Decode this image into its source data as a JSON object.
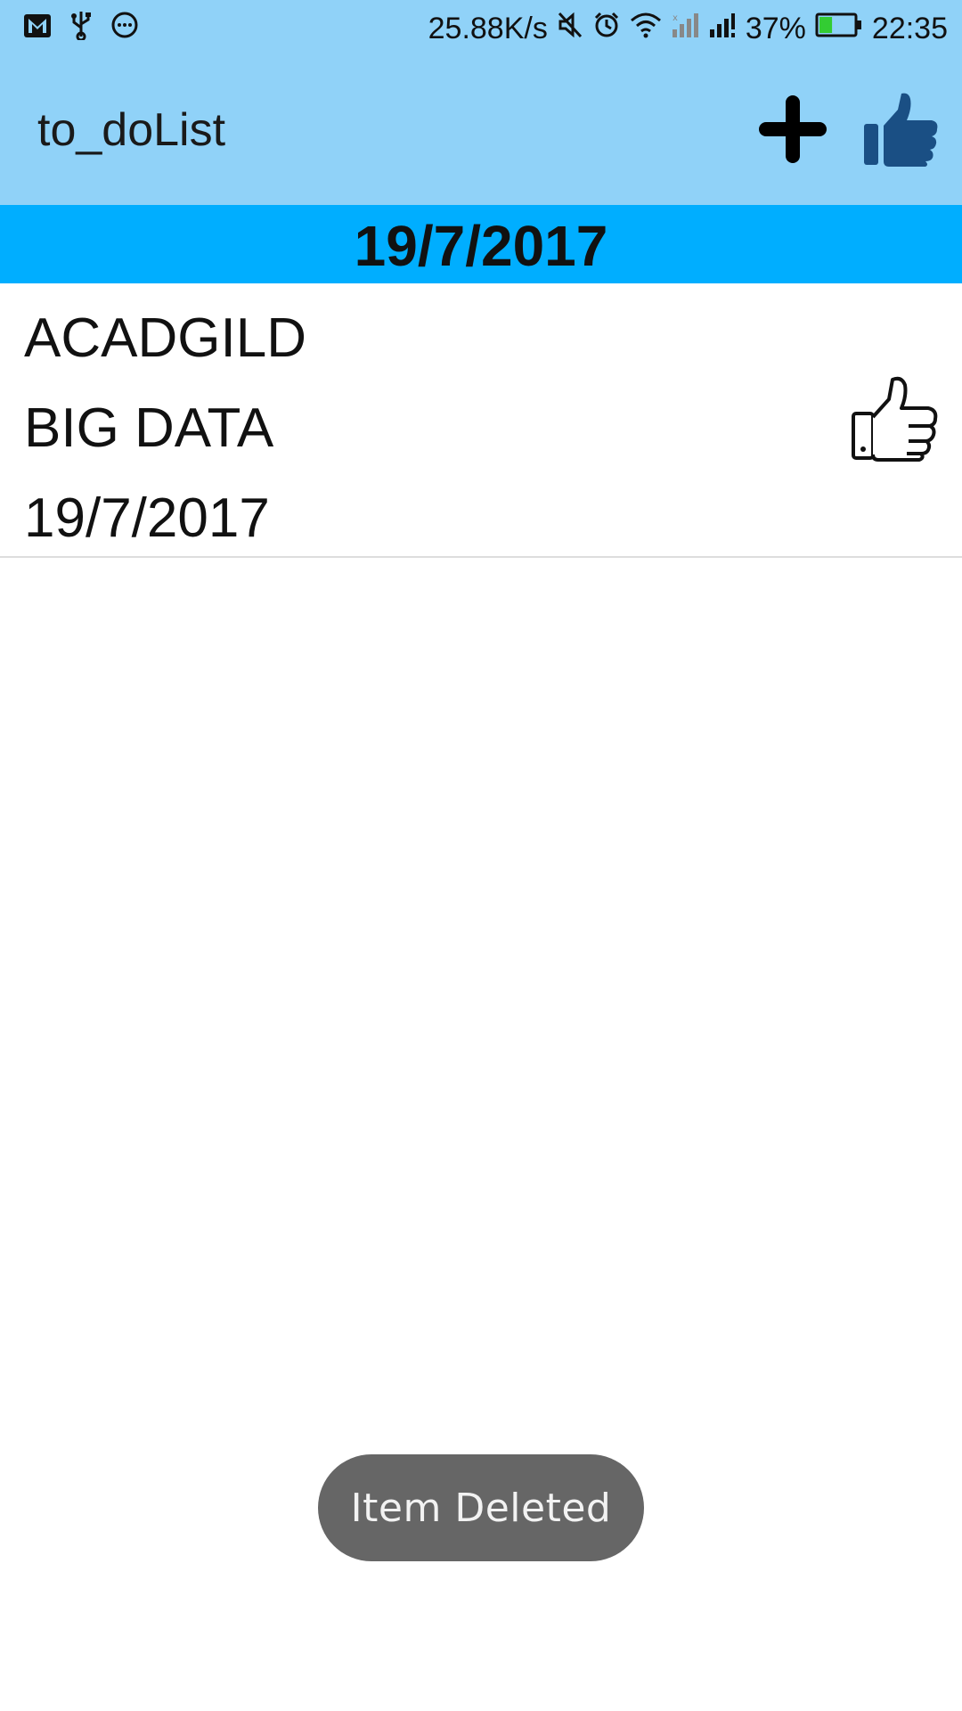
{
  "status_bar": {
    "left_icons": [
      "gmail-icon",
      "usb-icon",
      "messenger-icon"
    ],
    "network_speed": "25.88K/s",
    "right_icons": [
      "mute-icon",
      "alarm-icon",
      "wifi-icon",
      "signal-1-icon",
      "signal-2-icon"
    ],
    "battery_percent": "37%",
    "battery_level": 0.37,
    "battery_color": "#33cc33",
    "time": "22:35"
  },
  "app_bar": {
    "title": "to_doList",
    "background": "#90d2f8",
    "actions": [
      {
        "name": "add-icon"
      },
      {
        "name": "thumbs-up-icon",
        "color": "#1a4f84"
      }
    ]
  },
  "date_header": {
    "label": "19/7/2017",
    "background": "#00aeff"
  },
  "list": {
    "items": [
      {
        "title": "ACADGILD",
        "description": "BIG DATA",
        "date": "19/7/2017",
        "action_icon": "thumbs-up-outline-icon"
      }
    ]
  },
  "toast": {
    "message": "Item Deleted",
    "background": "#666666"
  }
}
